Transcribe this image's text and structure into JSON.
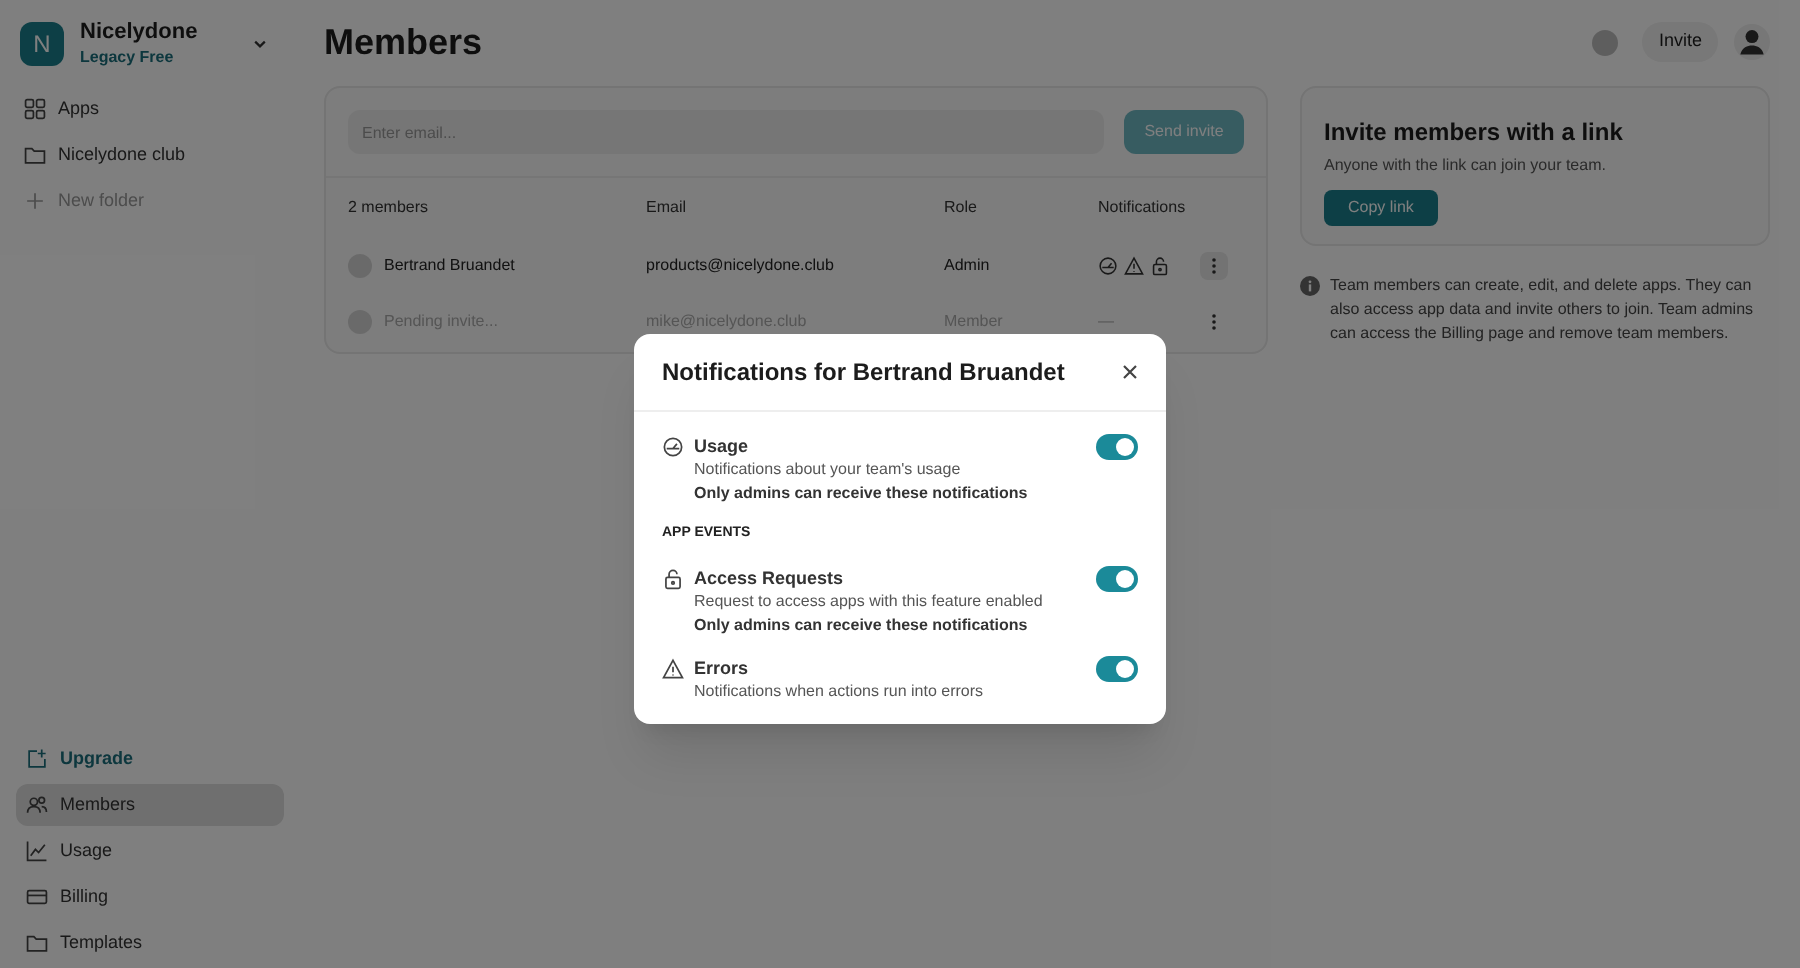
{
  "workspace": {
    "initial": "N",
    "name": "Nicelydone",
    "plan": "Legacy Free"
  },
  "nav": [
    {
      "label": "Apps",
      "muted": false
    },
    {
      "label": "Nicelydone club",
      "muted": false
    },
    {
      "label": "New folder",
      "muted": true
    }
  ],
  "bottom_nav": [
    {
      "label": "Upgrade",
      "accent": true,
      "selected": false
    },
    {
      "label": "Members",
      "accent": false,
      "selected": true
    },
    {
      "label": "Usage",
      "accent": false,
      "selected": false
    },
    {
      "label": "Billing",
      "accent": false,
      "selected": false
    },
    {
      "label": "Templates",
      "accent": false,
      "selected": false
    }
  ],
  "page_title": "Members",
  "header_button": "Invite",
  "invite_form": {
    "placeholder": "Enter email...",
    "button": "Send invite"
  },
  "table": {
    "columns": [
      "2 members",
      "Email",
      "Role",
      "Notifications"
    ],
    "rows": [
      {
        "kind": "member",
        "name": "Bertrand Bruandet",
        "email": "products@nicelydone.club",
        "role": "Admin"
      },
      {
        "kind": "pending",
        "name": "Pending invite...",
        "email": "mike@nicelydone.club",
        "role": "Member",
        "notifications_text": "—"
      }
    ]
  },
  "link_card": {
    "title": "Invite members with a link",
    "text": "Anyone with the link can join your team.",
    "button": "Copy link"
  },
  "info_text": "Team members can create, edit, and delete apps. They can also access app data and invite others to join. Team admins can access the Billing page and remove team members.",
  "modal": {
    "title": "Notifications for Bertrand Bruandet",
    "items": [
      {
        "kind": "setting",
        "title": "Usage",
        "description": "Notifications about your team's usage",
        "note": "Only admins can receive these notifications",
        "on": true
      },
      {
        "kind": "heading",
        "title": "APP EVENTS"
      },
      {
        "kind": "setting",
        "title": "Access Requests",
        "description": "Request to access apps with this feature enabled",
        "note": "Only admins can receive these notifications",
        "on": true
      },
      {
        "kind": "setting",
        "title": "Errors",
        "description": "Notifications when actions run into errors",
        "on": true
      }
    ]
  }
}
